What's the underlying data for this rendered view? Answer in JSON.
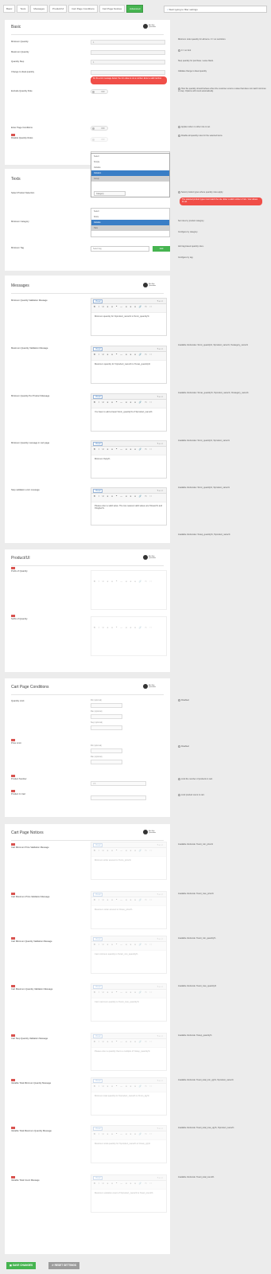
{
  "tabs": [
    "Basic",
    "Texts",
    "Messages",
    "Product/UI",
    "Cart Page Conditions",
    "Cart Page Notices",
    "Advanced"
  ],
  "search_placeholder": "Start typing to filter settings",
  "logo_text": "Min Max Quantities",
  "basic": {
    "title": "Basic",
    "fields": [
      {
        "label": "Minimum Quantity",
        "value": "1"
      },
      {
        "label": "Maximum Quantity",
        "value": ""
      },
      {
        "label": "Quantity Step",
        "value": "1"
      },
      {
        "label": "Change to ideal quantity",
        "value": ""
      }
    ],
    "error_text": "Fix the error message below: the min value is not a number. Enter a valid number.",
    "toggles": [
      {
        "label": "Exclude Quantity Rule",
        "state": "OFF"
      },
      {
        "label": "Enter Page Conditions",
        "state": "OFF"
      },
      {
        "label": "Disable Quantity Rules",
        "state": "OFF"
      }
    ],
    "help": [
      "Minimum order quantity for all items. 0 = no restriction.",
      "0 = no limit",
      "Step quantity for purchase. Leave blank.",
      "Validate change to ideal quantity",
      "How the quantity should behave when the customer enters a value that does not match min/max or step. Options will round automatically.",
      "Applies when no other rule is set.",
      "Disable all quantity rules for the selected items."
    ],
    "list": [
      "Select",
      "Simple",
      "Variable",
      "Variation",
      "Group"
    ]
  },
  "texts": {
    "title": "Texts",
    "select_label": "Select Product Selection",
    "list1": [
      "Select",
      "Simple",
      "Variable",
      "Variation",
      "Group"
    ],
    "category_label": "Minimum Category",
    "list2": [
      "Select",
      "Shirts",
      "Variable",
      "Hats"
    ],
    "tag_label": "Minimum Tag",
    "add": "Add",
    "help1": "Select product types where quantity rules apply.",
    "err": "The selected product types must match the rule. Enter a valid number of min / max values for all.",
    "help2": "Set rules by product category.",
    "help3": "Configure by category.",
    "help4": "Add tag-based quantity rules.",
    "help5": "Configure by tag.",
    "compact_label": "Category",
    "tag_value": "Select tag"
  },
  "messages": {
    "title": "Messages",
    "editor_tab": "Visual",
    "editor_right": "Text",
    "toolbar": "B I U ≡ ≡ ❝ — ≡ ≡ ≡ 🔗 ✂ ⛶",
    "items": [
      {
        "label": "Minimum Quantity Validation Message",
        "body": "Minimum quantity for %product_name% is %min_quantity%",
        "help": "Available shortcodes: %min_quantity%, %product_name%, %category_name%"
      },
      {
        "label": "Maximum Quantity Validation Message",
        "body": "Maximum quantity for %product_name% is %max_quantity%",
        "help": "Available shortcodes: %max_quantity%, %product_name%, %category_name%"
      },
      {
        "label": "Minimum Quantity Per Product Message",
        "body": "You have to add at least %min_quantity% of %product_name%",
        "help": "Available shortcodes: %min_quantity%, %product_name%"
      },
      {
        "label": "Minimum Quantity message in cart page",
        "body": "Minimum %qty%",
        "help": "Available shortcodes: %min_quantity%, %product_name%"
      },
      {
        "label": "Step validation error message",
        "body": "Please enter a valid value. The two nearest valid values are %lower% and %higher%.",
        "help": "Available shortcodes: %step_quantity%, %product_name%"
      }
    ]
  },
  "product": {
    "title": "Product/UI",
    "items": [
      {
        "label": "Prefix of Quantity"
      },
      {
        "label": "Suffix of Quantity"
      }
    ]
  },
  "cart_conditions": {
    "title": "Cart Page Conditions",
    "items": [
      {
        "label": "Quantity Limit",
        "help": "Disabled",
        "vals": [
          "Min (optional)",
          "Max (optional)",
          "Step (optional)"
        ]
      },
      {
        "label": "Price Limit",
        "help": "Disabled",
        "vals": [
          "Min (optional)",
          "Max (optional)"
        ]
      },
      {
        "label": "Product Number",
        "help": "Limit the number of products in cart.",
        "vals": [
          "0.5"
        ]
      },
      {
        "label": "Product In Cart",
        "help": "Limit product count in cart.",
        "vals": [
          ""
        ]
      }
    ]
  },
  "cart_notices": {
    "title": "Cart Page Notices",
    "items": [
      {
        "label": "Cart Minimum Price Validation Message",
        "body": "Minimum order amount is %min_price%",
        "help": "Available shortcode: %cart_min_price%"
      },
      {
        "label": "Cart Maximum Price Validation Message",
        "body": "Maximum order amount is %max_price%",
        "help": "Available shortcode: %cart_max_price%"
      },
      {
        "label": "Cart Minimum Quantity Validation Message",
        "body": "Cart minimum quantity is %cart_min_quantity%",
        "help": "Available shortcode: %cart_min_quantity%"
      },
      {
        "label": "Cart Maximum Quantity Validation Message",
        "body": "Cart maximum quantity is %cart_max_quantity%",
        "help": "Available shortcode: %cart_max_quantity%"
      },
      {
        "label": "Cart Step Quantity Validation Message",
        "body": "Please enter a quantity that is a multiple of %step_quantity%",
        "help": "Available shortcode: %step_quantity%"
      },
      {
        "label": "Variable Total Minimum Quantity Message",
        "body": "Minimum total quantity for %product_name% is %min_qty%",
        "help": "Available shortcode: %vari_total_min_qty%, %product_name%"
      },
      {
        "label": "Variable Total Maximum Quantity Message",
        "body": "Maximum total quantity for %product_name% is %max_qty%",
        "help": "Available shortcode: %vari_total_max_qty%, %product_name%"
      },
      {
        "label": "Variable Total Count Message",
        "body": "Maximum variation count of %product_name% is %vari_count%",
        "help": "Available shortcode: %vari_total_count%"
      }
    ]
  },
  "buttons": {
    "save": "SAVE CHANGES",
    "reset": "RESET SETTINGS"
  }
}
